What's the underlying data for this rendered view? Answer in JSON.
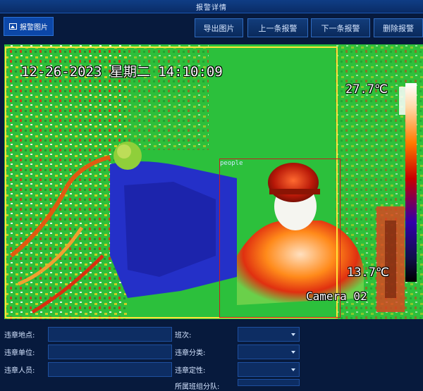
{
  "window": {
    "title": "报警详情"
  },
  "tabs": [
    {
      "label": "报警图片",
      "icon": "image-icon",
      "active": true
    }
  ],
  "toolbar": {
    "export_label": "导出图片",
    "prev_label": "上一条报警",
    "next_label": "下一条报警",
    "delete_label": "删除报警"
  },
  "viewer": {
    "timestamp": "12-26-2023 星期二 14:10:09",
    "temp_max": "27.7℃",
    "temp_min": "13.7℃",
    "camera": "Camera 02",
    "detection_label": "people"
  },
  "form": {
    "location_label": "违章地点:",
    "unit_label": "违章单位:",
    "person_label": "违章人员:",
    "shift_label": "班次:",
    "category_label": "违章分类:",
    "nature_label": "违章定性:",
    "extra_label": "所属班组分队:"
  },
  "colors": {
    "accent": "#0c47a8",
    "background": "#071a3d",
    "detection_box": "#c81e1e"
  }
}
